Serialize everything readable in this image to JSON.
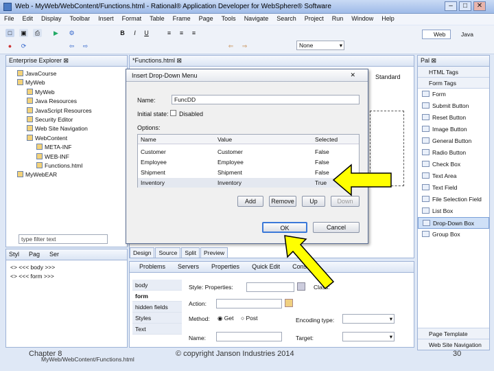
{
  "window": {
    "title": "Web - MyWeb/WebContent/Functions.html - Rational® Application Developer for WebSphere® Software",
    "min": "–",
    "max": "□",
    "close": "✕"
  },
  "menu": [
    "File",
    "Edit",
    "Display",
    "Toolbar",
    "Insert",
    "Format",
    "Table",
    "Frame",
    "Page",
    "Tools",
    "Navigate",
    "Search",
    "Project",
    "Run",
    "Window",
    "Help"
  ],
  "toolbar": {
    "font_value": "None",
    "perspective": "Web",
    "perspective2": "Java"
  },
  "explorer": {
    "tab": "Enterprise Explorer",
    "filter_placeholder": "type filter text",
    "items": [
      {
        "label": "JavaCourse",
        "indent": 0
      },
      {
        "label": "MyWeb",
        "indent": 0
      },
      {
        "label": "MyWeb",
        "indent": 1
      },
      {
        "label": "Java Resources",
        "indent": 1
      },
      {
        "label": "JavaScript Resources",
        "indent": 1
      },
      {
        "label": "Security Editor",
        "indent": 1
      },
      {
        "label": "Web Site Navigation",
        "indent": 1
      },
      {
        "label": "WebContent",
        "indent": 1
      },
      {
        "label": "META-INF",
        "indent": 2
      },
      {
        "label": "WEB-INF",
        "indent": 2
      },
      {
        "label": "Functions.html",
        "indent": 2
      },
      {
        "label": "MyWebEAR",
        "indent": 0
      }
    ]
  },
  "editor": {
    "tab": "*Functions.html",
    "standard": "Standard",
    "bottom_tabs": [
      "Design",
      "Source",
      "Split",
      "Preview"
    ]
  },
  "dialog": {
    "title": "Insert Drop-Down Menu",
    "name_label": "Name:",
    "name_value": "FuncDD",
    "initial_label": "Initial state:",
    "disabled_label": "Disabled",
    "options_label": "Options:",
    "columns": [
      "Name",
      "Value",
      "Selected"
    ],
    "rows": [
      [
        "Customer",
        "Customer",
        "False"
      ],
      [
        "Employee",
        "Employee",
        "False"
      ],
      [
        "Shipment",
        "Shipment",
        "False"
      ],
      [
        "Inventory",
        "Inventory",
        "True"
      ]
    ],
    "buttons": {
      "add": "Add",
      "remove": "Remove",
      "up": "Up",
      "down": "Down",
      "ok": "OK",
      "cancel": "Cancel"
    }
  },
  "styles_pane": {
    "tabs": [
      "Styl",
      "Pag",
      "Ser"
    ],
    "lines": [
      "<> <<< body >>>",
      "<> <<< form >>>"
    ]
  },
  "properties": {
    "tabs": [
      "Problems",
      "Servers",
      "Properties",
      "Quick Edit",
      "Console"
    ],
    "left_items": [
      "body",
      "form",
      "hidden fields",
      "Styles",
      "Text"
    ],
    "style_label": "Style: Properties:",
    "class_label": "Class:",
    "action_label": "Action:",
    "method_label": "Method:",
    "get_label": "Get",
    "post_label": "Post",
    "encoding_label": "Encoding type:",
    "name_label": "Name:",
    "target_label": "Target:"
  },
  "palette": {
    "tabs": [
      "HTML Tags",
      "Form Tags"
    ],
    "items": [
      "Form",
      "Submit Button",
      "Reset Button",
      "Image Button",
      "General Button",
      "Radio Button",
      "Check Box",
      "Text Area",
      "Text Field",
      "File Selection Field",
      "List Box",
      "Drop-Down Box",
      "Group Box"
    ],
    "bottom": [
      "Page Template",
      "Web Site Navigation"
    ]
  },
  "status": {
    "path": "MyWeb/WebContent/Functions.html"
  },
  "footer": {
    "chapter": "Chapter 8",
    "copyright": "© copyright Janson Industries 2014",
    "page": "30"
  },
  "colors": {
    "arrow": "#ffff00",
    "arrow_border": "#000000",
    "accent": "#9db2d6"
  }
}
